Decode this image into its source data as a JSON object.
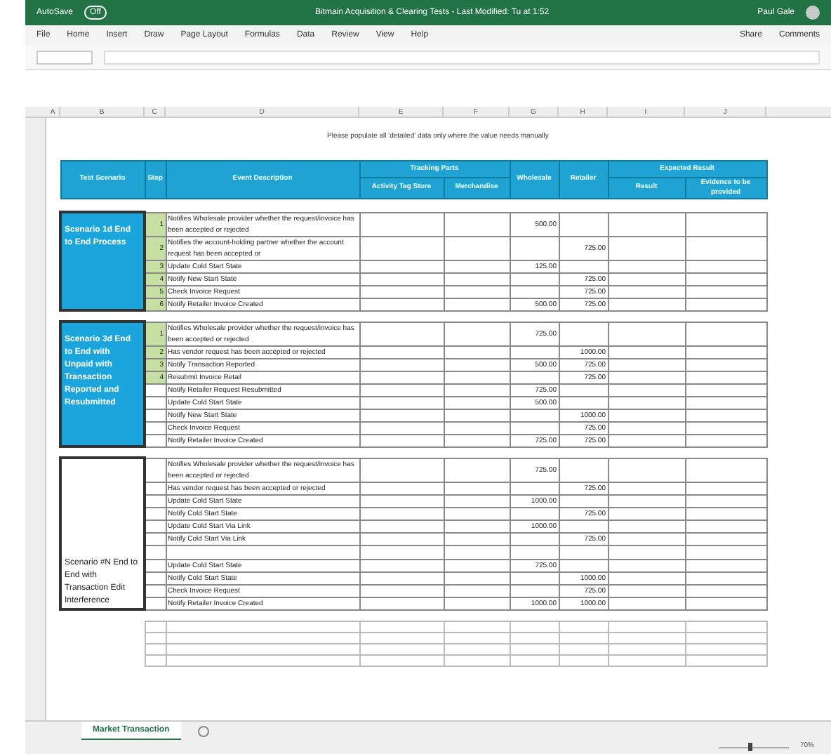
{
  "title_bar": {
    "autosave_label": "AutoSave",
    "autosave_state": "Off",
    "document_title": "Bitmain Acquisition & Clearing Tests - Last Modified: Tu at 1:52",
    "user": "Paul Gale"
  },
  "menu": {
    "tabs": [
      "File",
      "Home",
      "Insert",
      "Draw",
      "Page Layout",
      "Formulas",
      "Data",
      "Review",
      "View",
      "Help"
    ],
    "share": "Share",
    "comments": "Comments"
  },
  "columns": [
    "A",
    "B",
    "C",
    "D",
    "E",
    "F",
    "G",
    "H",
    "I",
    "J"
  ],
  "sheet": {
    "note": "Please populate all 'detailed' data only where the value needs manually",
    "headers": {
      "scenario": "Test Scenario",
      "step": "Step",
      "description": "Event Description",
      "tracking_group": "Tracking Parts",
      "tracking_1": "Activity Tag Store",
      "tracking_2": "Merchandise",
      "wholesale": "Wholesale",
      "retailer": "Retailer",
      "expected_group": "Expected Result",
      "result": "Result",
      "evidence": "Evidence to be provided"
    },
    "sections": [
      {
        "title": "Scenario 1d End to End Process",
        "highlighted": true,
        "rows": [
          {
            "step": "1",
            "description": "Notifies Wholesale provider whether the request/invoice has been accepted or rejected",
            "wholesale": "500.00"
          },
          {
            "step": "2",
            "description": "Notifies the account-holding partner whether the account request has been accepted or",
            "retailer": "725.00"
          },
          {
            "step": "3",
            "description": "Update Cold Start State",
            "wholesale": "125.00"
          },
          {
            "step": "4",
            "description": "Notify New Start State",
            "retailer": "725.00"
          },
          {
            "step": "5",
            "description": "Check Invoice Request",
            "retailer": "725.00"
          },
          {
            "step": "6",
            "description": "Notify Retailer Invoice Created",
            "wholesale": "500.00",
            "retailer": "725.00"
          }
        ]
      },
      {
        "title": "Scenario 3d End to End with Unpaid with Transaction Reported and Resubmitted",
        "highlighted": true,
        "rows": [
          {
            "step": "1",
            "description": "Notifies Wholesale provider whether the request/invoice has been accepted or rejected",
            "wholesale": "725.00"
          },
          {
            "step": "2",
            "description": "Has vendor request has been accepted or rejected",
            "retailer": "1000.00"
          },
          {
            "step": "3",
            "description": "Notify Transaction Reported",
            "wholesale": "500.00",
            "retailer": "725.00"
          },
          {
            "step": "4",
            "description": "Resubmit Invoice Retail",
            "retailer": "725.00"
          },
          {
            "description": "Notify Retailer Request Resubmitted",
            "wholesale": "725.00"
          },
          {
            "description": "Update Cold Start State",
            "wholesale": "500.00"
          },
          {
            "description": "Notify New Start State",
            "retailer": "1000.00"
          },
          {
            "description": "Check Invoice Request",
            "retailer": "725.00"
          },
          {
            "description": "Notify Retailer Invoice Created",
            "wholesale": "725.00",
            "retailer": "725.00"
          }
        ]
      },
      {
        "title": "Scenario #N End to End with Transaction Edit Interference",
        "highlighted": false,
        "rows": [
          {
            "description": "Notifies Wholesale provider whether the request/invoice has been accepted or rejected",
            "wholesale": "725.00"
          },
          {
            "description": "Has vendor request has been accepted or rejected",
            "retailer": "725.00"
          },
          {
            "description": "Update Cold Start State",
            "wholesale": "1000.00"
          },
          {
            "description": "Notify Cold Start State",
            "retailer": "725.00"
          },
          {
            "description": "Update Cold Start Via Link",
            "wholesale": "1000.00"
          },
          {
            "description": "Notify Cold Start Via Link",
            "retailer": "725.00"
          },
          {},
          {
            "description": "Update Cold Start State",
            "wholesale": "725.00"
          },
          {
            "description": "Notify Cold Start State",
            "retailer": "1000.00"
          },
          {
            "description": "Check Invoice Request",
            "retailer": "725.00"
          },
          {
            "description": "Notify Retailer Invoice Created",
            "wholesale": "1000.00",
            "retailer": "1000.00"
          }
        ]
      }
    ]
  },
  "sheet_tabs": [
    {
      "label": "Market Transaction",
      "selected": true
    }
  ],
  "status_bar": {
    "zoom_slider": {
      "level": 0.45
    },
    "zoom": "70%"
  }
}
